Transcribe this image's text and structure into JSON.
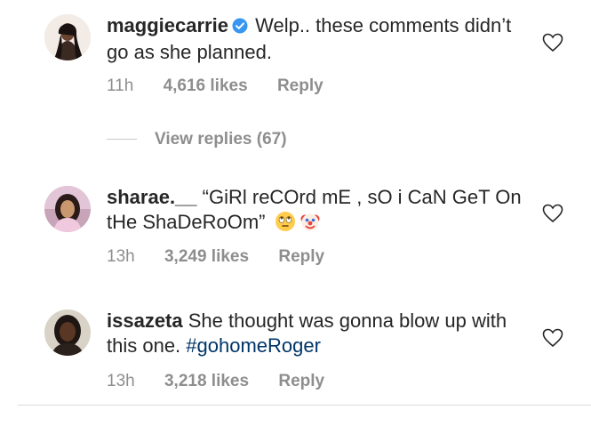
{
  "comments": [
    {
      "username": "maggiecarrie",
      "verified": true,
      "text": "Welp.. these comments didn’t go as she planned.",
      "time": "11h",
      "likes": "4,616 likes",
      "reply_label": "Reply"
    },
    {
      "username": "sharae.__",
      "verified": false,
      "text": "“GiRl reCOrd mE , sO i CaN GeT On tHe ShaDeRoOm”",
      "emojis": [
        "face-with-rolling-eyes-emoji",
        "clown-face-emoji"
      ],
      "time": "13h",
      "likes": "3,249 likes",
      "reply_label": "Reply"
    },
    {
      "username": "issazeta",
      "verified": false,
      "text_prefix": "She thought was gonna blow up with this one.",
      "hashtag": "#gohomeRoger",
      "time": "13h",
      "likes": "3,218 likes",
      "reply_label": "Reply"
    }
  ],
  "view_replies_label": "View replies (67)",
  "colors": {
    "text": "#262626",
    "meta": "#8e8e8e",
    "verified": "#3897f0",
    "hashtag": "#003569"
  }
}
